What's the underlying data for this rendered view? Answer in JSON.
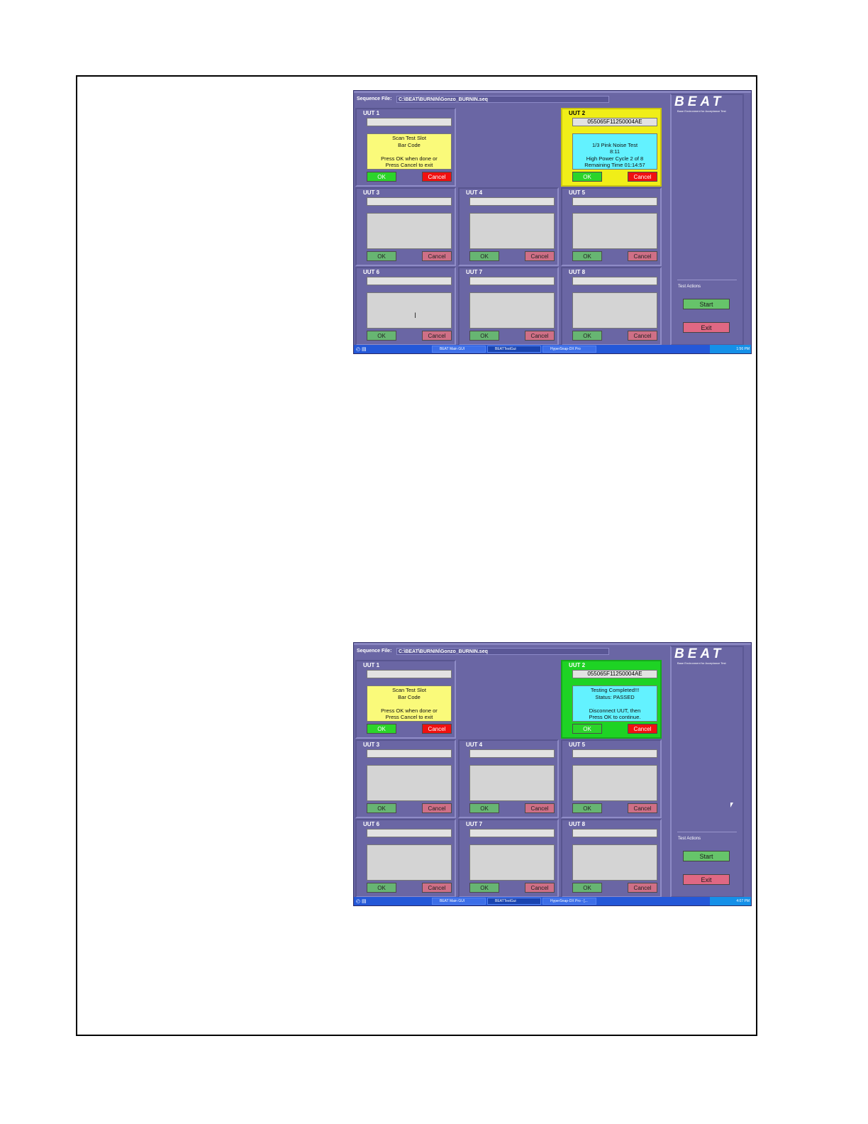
{
  "screens": [
    {
      "sequence_label": "Sequence File:",
      "sequence_value": "C:\\BEAT\\BURNIN\\Gonzo_BURNIN.seq",
      "logo": "BEAT",
      "logo_tagline": "Base Environment for Acceptance Test",
      "test_actions_label": "Test Actions",
      "start_label": "Start",
      "exit_label": "Exit",
      "uut1": {
        "title": "UUT 1",
        "field": "",
        "msg": [
          "Scan Test Slot",
          "Bar Code",
          "",
          "Press OK when done or",
          "Press Cancel to exit"
        ],
        "ok": "OK",
        "cancel": "Cancel"
      },
      "uut2": {
        "title": "UUT 2",
        "field": "055065F11250004AE",
        "msg": [
          "",
          "1/3 Pink Noise Test",
          "8:11",
          "High Power Cycle 2 of 8",
          "Remaining Time 01:14:57"
        ],
        "ok": "OK",
        "cancel": "Cancel"
      },
      "uut3": {
        "title": "UUT 3",
        "ok": "OK",
        "cancel": "Cancel"
      },
      "uut4": {
        "title": "UUT 4",
        "ok": "OK",
        "cancel": "Cancel"
      },
      "uut5": {
        "title": "UUT 5",
        "ok": "OK",
        "cancel": "Cancel"
      },
      "uut6": {
        "title": "UUT 6",
        "ok": "OK",
        "cancel": "Cancel"
      },
      "uut7": {
        "title": "UUT 7",
        "ok": "OK",
        "cancel": "Cancel"
      },
      "uut8": {
        "title": "UUT 8",
        "ok": "OK",
        "cancel": "Cancel"
      },
      "taskbar": [
        "BEAT Main GUI",
        "BEATTestGui",
        "HyperSnap-DX Pro"
      ],
      "clock": "1:56 PM"
    },
    {
      "sequence_label": "Sequence File:",
      "sequence_value": "C:\\BEAT\\BURNIN\\Gonzo_BURNIN.seq",
      "logo": "BEAT",
      "logo_tagline": "Base Environment for Acceptance Test",
      "test_actions_label": "Test Actions",
      "start_label": "Start",
      "exit_label": "Exit",
      "uut1": {
        "title": "UUT 1",
        "field": "",
        "msg": [
          "Scan Test Slot",
          "Bar Code",
          "",
          "Press OK when done or",
          "Press Cancel to exit"
        ],
        "ok": "OK",
        "cancel": "Cancel"
      },
      "uut2": {
        "title": "UUT 2",
        "field": "055065F11250004AE",
        "msg": [
          "Testing Completed!!!",
          "Status: PASSED",
          "",
          "Disconnect UUT, then",
          "Press OK to continue."
        ],
        "ok": "OK",
        "cancel": "Cancel"
      },
      "uut3": {
        "title": "UUT 3",
        "ok": "OK",
        "cancel": "Cancel"
      },
      "uut4": {
        "title": "UUT 4",
        "ok": "OK",
        "cancel": "Cancel"
      },
      "uut5": {
        "title": "UUT 5",
        "ok": "OK",
        "cancel": "Cancel"
      },
      "uut6": {
        "title": "UUT 6",
        "ok": "OK",
        "cancel": "Cancel"
      },
      "uut7": {
        "title": "UUT 7",
        "ok": "OK",
        "cancel": "Cancel"
      },
      "uut8": {
        "title": "UUT 8",
        "ok": "OK",
        "cancel": "Cancel"
      },
      "taskbar": [
        "BEAT Main GUI",
        "BEATTestGui",
        "HyperSnap-DX Pro - [..."
      ],
      "clock": "4:07 PM"
    }
  ]
}
